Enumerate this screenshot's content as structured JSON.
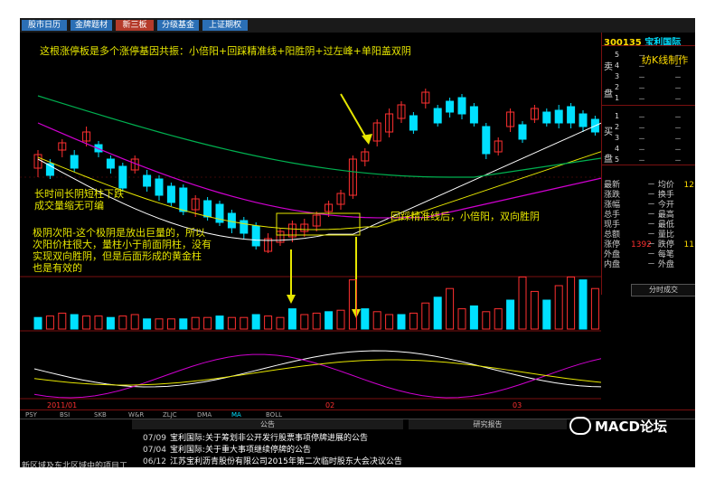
{
  "tabs": [
    "股市日历",
    "金牌题材",
    "新三板",
    "分级基金",
    "上证期权"
  ],
  "annotations": {
    "title": "这根涨停板是多个涨停基因共振：小倍阳+回踩精准线+阳胜阴+过左峰+单阳盖双阴",
    "note1": [
      "长时间长阴短柱下跌",
      "成交量缩无可编"
    ],
    "note2": [
      "极阴次阳-这个极阴是放出巨量的，所以",
      "次阳价柱很大，量柱小于前面阴柱，没有",
      "实现双向胜阴，但是后面形成的黄金柱",
      "也是有效的"
    ],
    "note3": "回踩精准线后，小倍阳，双向胜阴"
  },
  "stock": {
    "code": "300135",
    "name": "宝利国际",
    "watermark_cell": "纺K线制作"
  },
  "orderbook": {
    "sell_label": "卖盘",
    "buy_label": "买盘",
    "levels": [
      "5",
      "4",
      "3",
      "2",
      "1",
      "1",
      "2",
      "3",
      "4",
      "5"
    ],
    "dash": "－"
  },
  "stats": [
    {
      "k": "最新",
      "k2": "均价",
      "v1": "",
      "v": "12"
    },
    {
      "k": "涨跌",
      "k2": "换手",
      "v1": "",
      "v": ""
    },
    {
      "k": "涨幅",
      "k2": "今开",
      "v1": "",
      "v": ""
    },
    {
      "k": "总手",
      "k2": "最高",
      "v1": "",
      "v": ""
    },
    {
      "k": "现手",
      "k2": "最低",
      "v1": "",
      "v": ""
    },
    {
      "k": "总额",
      "k2": "量比",
      "v1": "",
      "v": ""
    },
    {
      "k": "涨停",
      "k2": "跌停",
      "v1": "1392",
      "v": "11"
    },
    {
      "k": "外盘",
      "k2": "每笔",
      "v1": "",
      "v": ""
    },
    {
      "k": "内盘",
      "k2": "外盘",
      "v1": "",
      "v": ""
    }
  ],
  "time_button": "分时成交",
  "date_labels": [
    "2011/01",
    "02",
    "03"
  ],
  "indicators": [
    "PSY",
    "BSI",
    "SKB",
    "W&R",
    "ZLJC",
    "DMA",
    "MA",
    "BOLL"
  ],
  "news_header": "公告",
  "news_header2": "研究报告",
  "news": [
    {
      "date": "07/09",
      "text": "宝利国际:关于筹划非公开发行股票事项停牌进展的公告"
    },
    {
      "date": "07/04",
      "text": "宝利国际:关于重大事项继续停牌的公告"
    },
    {
      "date": "06/12",
      "text": "江苏宝利沥青股份有限公司2015年第二次临时股东大会决议公告"
    }
  ],
  "left_news": "新区域及东北区域中的项目工",
  "watermark": "MACD论坛",
  "colors": {
    "up": "#ff3030",
    "down": "#00e0ff",
    "ma_white": "#ffffff",
    "ma_yellow": "#e6e600",
    "ma_purple": "#d000d0",
    "ma_green": "#00b050",
    "annotation": "#e6e600"
  }
}
